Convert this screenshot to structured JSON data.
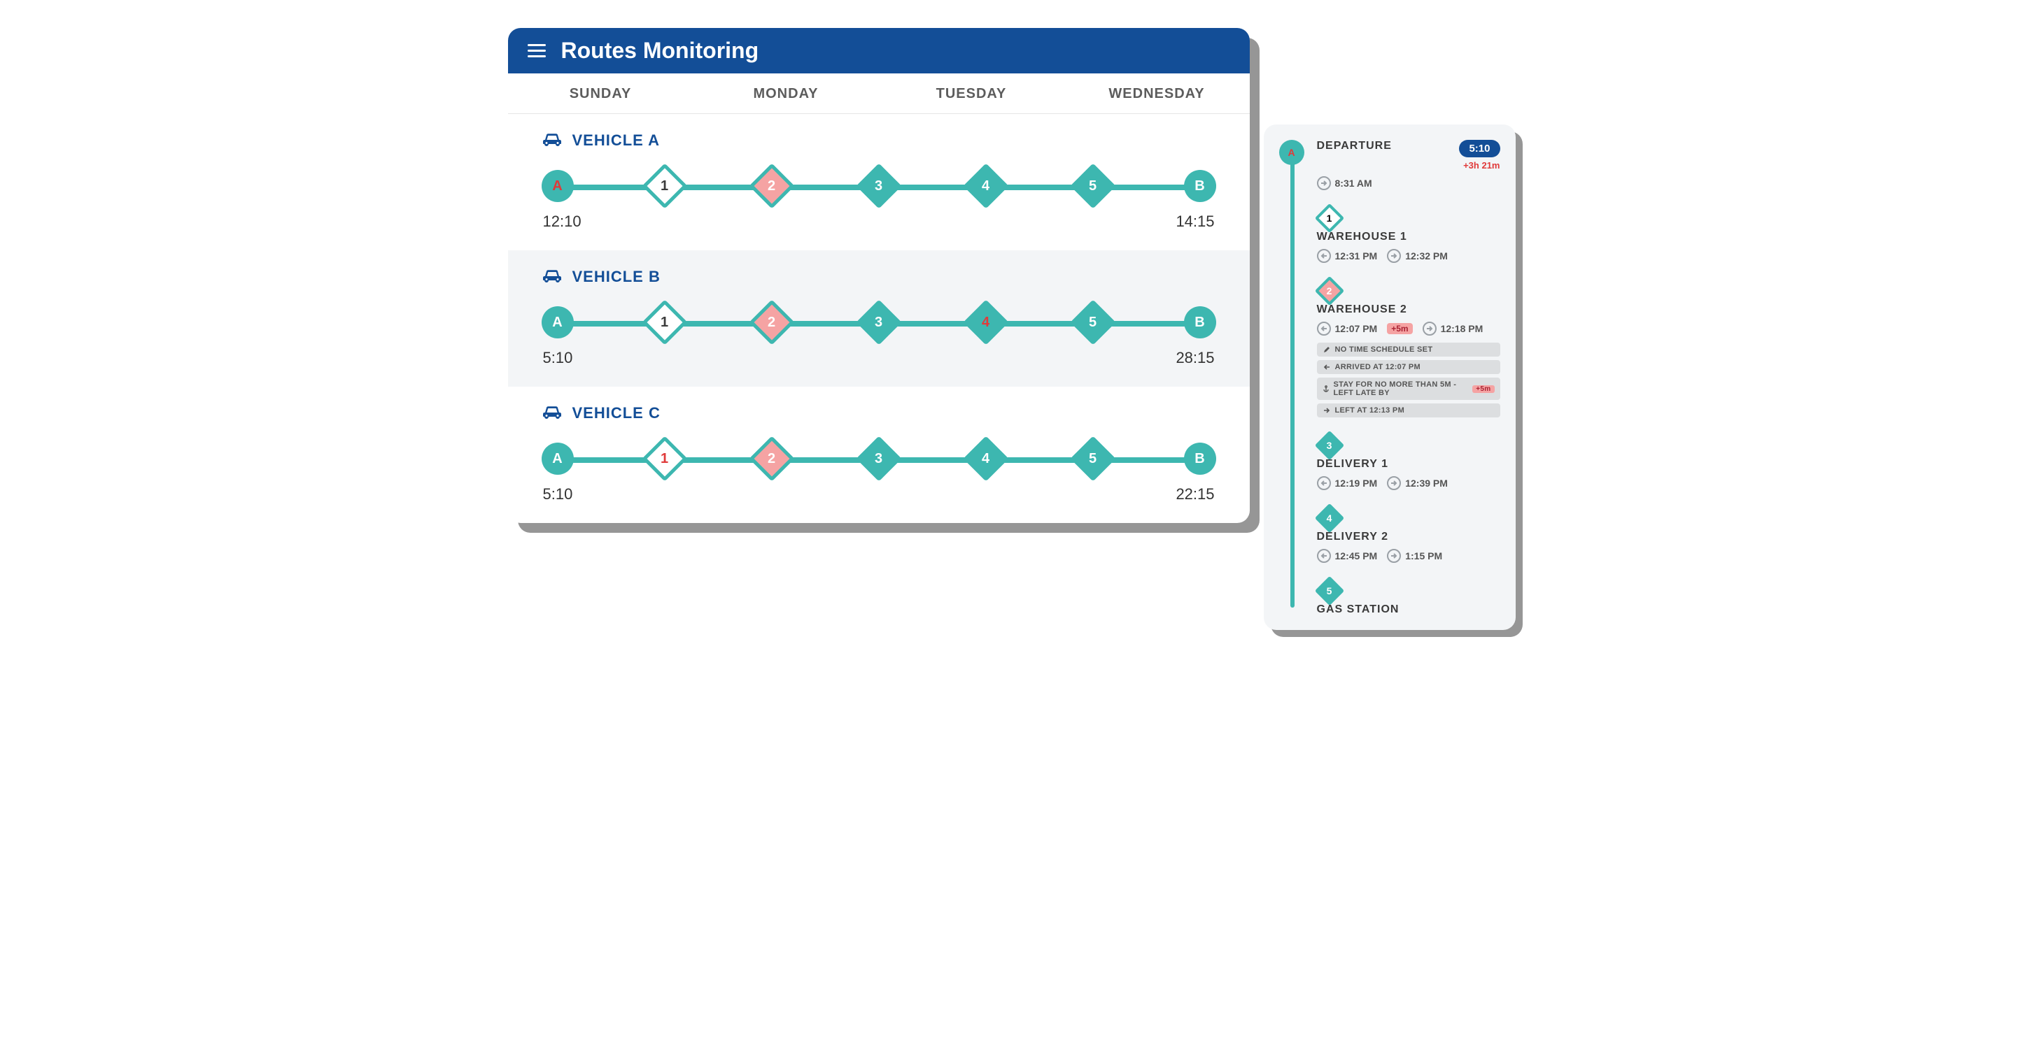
{
  "header": {
    "title": "Routes Monitoring",
    "days": [
      "SUNDAY",
      "MONDAY",
      "TUESDAY",
      "WEDNESDAY"
    ]
  },
  "vehicles": [
    {
      "name": "VEHICLE A",
      "start_label": "A",
      "start_time": "12:10",
      "end_label": "B",
      "end_time": "14:15",
      "stops": [
        {
          "n": "1",
          "style": "white"
        },
        {
          "n": "2",
          "style": "pink"
        },
        {
          "n": "3",
          "style": "teal"
        },
        {
          "n": "4",
          "style": "teal"
        },
        {
          "n": "5",
          "style": "teal"
        }
      ],
      "start_red": true
    },
    {
      "name": "VEHICLE B",
      "start_label": "A",
      "start_time": "5:10",
      "end_label": "B",
      "end_time": "28:15",
      "stops": [
        {
          "n": "1",
          "style": "white"
        },
        {
          "n": "2",
          "style": "pink"
        },
        {
          "n": "3",
          "style": "teal"
        },
        {
          "n": "4",
          "style": "teal",
          "red_text": true
        },
        {
          "n": "5",
          "style": "teal"
        }
      ],
      "start_red": false
    },
    {
      "name": "VEHICLE C",
      "start_label": "A",
      "start_time": "5:10",
      "end_label": "B",
      "end_time": "22:15",
      "stops": [
        {
          "n": "1",
          "style": "white",
          "red_text": true
        },
        {
          "n": "2",
          "style": "pink"
        },
        {
          "n": "3",
          "style": "teal"
        },
        {
          "n": "4",
          "style": "teal"
        },
        {
          "n": "5",
          "style": "teal"
        }
      ],
      "start_red": false
    }
  ],
  "detail": {
    "departure": {
      "title": "DEPARTURE",
      "pill_time": "5:10",
      "delta": "+3h 21m",
      "time": "8:31 AM"
    },
    "stops": [
      {
        "marker": "1",
        "style": "white",
        "title": "WAREHOUSE 1",
        "in_time": "12:31 PM",
        "out_time": "12:32 PM"
      },
      {
        "marker": "2",
        "style": "pink",
        "title": "WAREHOUSE 2",
        "in_time": "12:07 PM",
        "warn": "+5m",
        "out_time": "12:18 PM",
        "notes": [
          {
            "icon": "pencil",
            "text": "NO TIME SCHEDULE SET"
          },
          {
            "icon": "in",
            "text": "ARRIVED AT 12:07 PM"
          },
          {
            "icon": "anchor",
            "text": "STAY FOR NO MORE THAN 5M - LEFT LATE BY",
            "tag": "+5m"
          },
          {
            "icon": "out",
            "text": "LEFT AT 12:13 PM"
          }
        ]
      },
      {
        "marker": "3",
        "style": "teal",
        "title": "DELIVERY 1",
        "in_time": "12:19 PM",
        "out_time": "12:39 PM"
      },
      {
        "marker": "4",
        "style": "teal",
        "title": "DELIVERY 2",
        "in_time": "12:45 PM",
        "out_time": "1:15 PM"
      },
      {
        "marker": "5",
        "style": "teal",
        "title": "GAS STATION"
      }
    ]
  }
}
